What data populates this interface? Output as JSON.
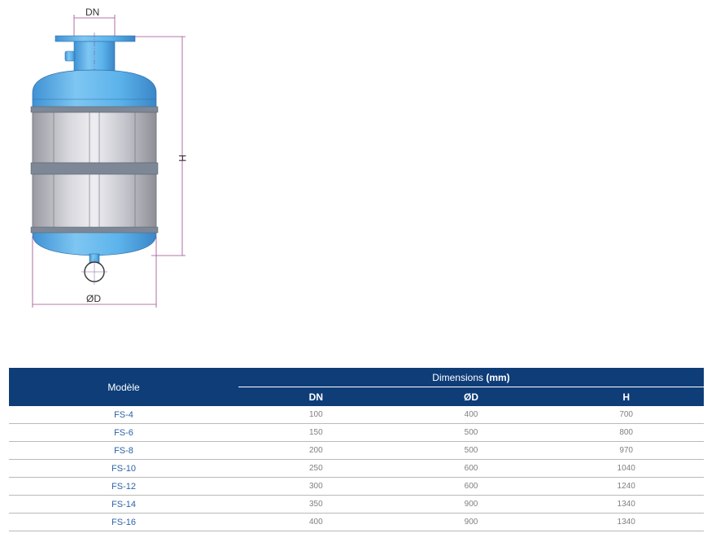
{
  "drawing": {
    "label_dn": "DN",
    "label_h": "H",
    "label_od": "ØD",
    "vessel_color": "#5cb3eb",
    "dimension_line_color": "#9c4a8c"
  },
  "table": {
    "header": {
      "model": "Modèle",
      "dimensions": "Dimensions",
      "unit": "(mm)",
      "col_dn": "DN",
      "col_od": "ØD",
      "col_h": "H"
    },
    "rows": [
      {
        "model": "FS-4",
        "dn": "100",
        "od": "400",
        "h": "700"
      },
      {
        "model": "FS-6",
        "dn": "150",
        "od": "500",
        "h": "800"
      },
      {
        "model": "FS-8",
        "dn": "200",
        "od": "500",
        "h": "970"
      },
      {
        "model": "FS-10",
        "dn": "250",
        "od": "600",
        "h": "1040"
      },
      {
        "model": "FS-12",
        "dn": "300",
        "od": "600",
        "h": "1240"
      },
      {
        "model": "FS-14",
        "dn": "350",
        "od": "900",
        "h": "1340"
      },
      {
        "model": "FS-16",
        "dn": "400",
        "od": "900",
        "h": "1340"
      }
    ],
    "header_color": "#0e3d78",
    "model_text_color": "#2d63a6"
  }
}
